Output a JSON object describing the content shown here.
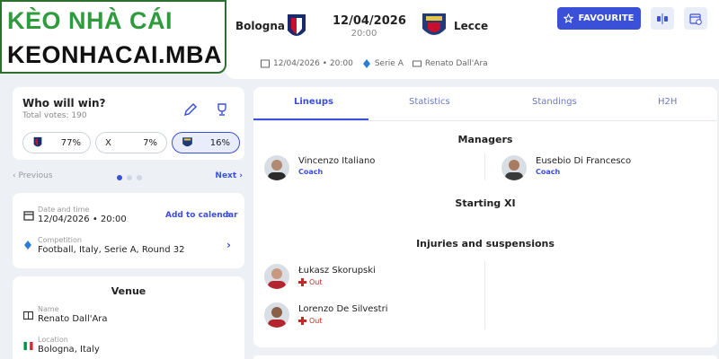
{
  "watermark": {
    "line1": "KÈO NHÀ CÁI",
    "line2": "KEONHACAI.MBA"
  },
  "match": {
    "home_team": "Bologna",
    "away_team": "Lecce",
    "date": "12/04/2026",
    "time": "20:00",
    "favourite_label": "FAVOURITE",
    "meta_datetime": "12/04/2026 • 20:00",
    "meta_league": "Serie A",
    "meta_venue": "Renato Dall'Ara"
  },
  "prediction": {
    "title": "Who will win?",
    "total_votes": "Total votes: 190",
    "options": [
      {
        "label": "",
        "percent": "77%"
      },
      {
        "label": "X",
        "percent": "7%"
      },
      {
        "label": "",
        "percent": "16%"
      }
    ],
    "prev_label": "Previous",
    "next_label": "Next"
  },
  "details": {
    "date_label": "Date and time",
    "date_value": "12/04/2026 • 20:00",
    "add_calendar": "Add to calendar",
    "competition_label": "Competition",
    "competition_value": "Football, Italy, Serie A, Round 32"
  },
  "venue": {
    "title": "Venue",
    "name_label": "Name",
    "name_value": "Renato Dall'Ara",
    "location_label": "Location",
    "location_value": "Bologna, Italy"
  },
  "tabs": [
    {
      "label": "Lineups"
    },
    {
      "label": "Statistics"
    },
    {
      "label": "Standings"
    },
    {
      "label": "H2H"
    }
  ],
  "lineups": {
    "managers_title": "Managers",
    "home_manager": {
      "name": "Vincenzo Italiano",
      "role": "Coach"
    },
    "away_manager": {
      "name": "Eusebio Di Francesco",
      "role": "Coach"
    },
    "starting_xi_title": "Starting XI",
    "injuries_title": "Injuries and suspensions",
    "injuries": [
      {
        "name": "Łukasz Skorupski",
        "status": "Out"
      },
      {
        "name": "Lorenzo De Silvestri",
        "status": "Out"
      }
    ]
  },
  "colors": {
    "accent": "#3b50d9",
    "brand_green": "#2e9b3c",
    "out_red": "#c62828"
  }
}
